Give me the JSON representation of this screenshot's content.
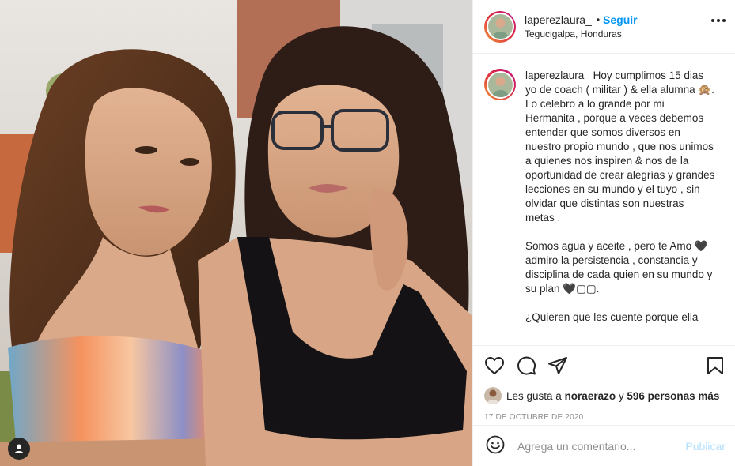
{
  "post": {
    "image_alt": "Foto de dos mujeres posando",
    "user_tag_icon": "user-tag-icon"
  },
  "header": {
    "username": "laperezlaura_",
    "separator": "•",
    "follow_label": "Seguir",
    "location": "Tegucigalpa, Honduras",
    "more_icon": "more-options-icon"
  },
  "caption": {
    "username": "laperezlaura_",
    "text": " Hoy cumplimos 15 dias yo de coach ( militar ) & ella alumna 🙊.\nLo celebro a lo grande por mi Hermanita , porque a veces debemos entender que somos diversos en nuestro propio mundo , que nos unimos a quienes nos inspiren & nos de la oportunidad de crear alegrías y grandes lecciones en su mundo y el tuyo , sin olvidar que distintas son nuestras metas .\n\nSomos agua y aceite , pero te Amo 🖤 admiro la persistencia , constancia y disciplina de cada quien en su mundo y su plan 🖤▢▢.\n\n¿Quieren que les cuente porque ella"
  },
  "actions": {
    "like_icon": "heart-icon",
    "comment_icon": "comment-icon",
    "share_icon": "share-icon",
    "save_icon": "bookmark-icon"
  },
  "likes": {
    "prefix": "Les gusta a ",
    "user": "noraerazo",
    "middle": " y ",
    "count": "596 personas más"
  },
  "date": "17 DE OCTUBRE DE 2020",
  "comment": {
    "emoji_icon": "emoji-icon",
    "placeholder": "Agrega un comentario...",
    "publish_label": "Publicar"
  },
  "colors": {
    "accent": "#0095f6",
    "publish_disabled": "#b2dffc",
    "muted": "#8e8e8e",
    "text": "#262626",
    "border": "#efefef"
  }
}
